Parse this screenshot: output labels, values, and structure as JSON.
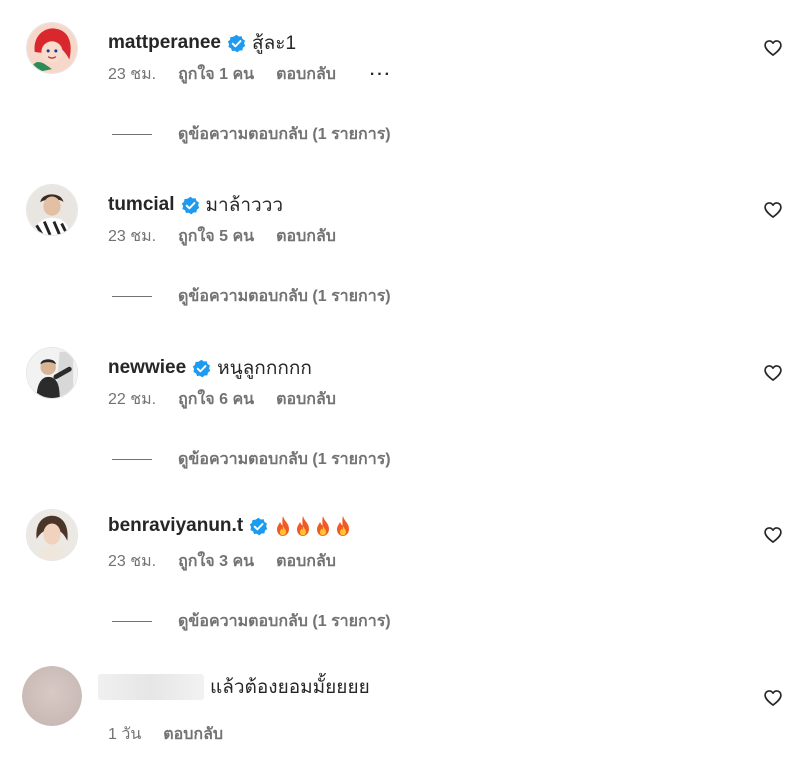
{
  "comments": [
    {
      "username": "mattperanee",
      "verified": true,
      "text": "สู้ละ1",
      "time": "23 ชม.",
      "likes": "ถูกใจ 1 คน",
      "reply": "ตอบกลับ",
      "more": "···",
      "view_replies": "ดูข้อความตอบกลับ (1 รายการ)",
      "avatar_icon": "cartoon-mermaid-avatar"
    },
    {
      "username": "tumcial",
      "verified": true,
      "text": "มาล้าววว",
      "time": "23 ชม.",
      "likes": "ถูกใจ 5 คน",
      "reply": "ตอบกลับ",
      "view_replies": "ดูข้อความตอบกลับ (1 รายการ)",
      "avatar_icon": "person-photo-avatar"
    },
    {
      "username": "newwiee",
      "verified": true,
      "text": "หนูลูกกกกก",
      "time": "22 ชม.",
      "likes": "ถูกใจ 6 คน",
      "reply": "ตอบกลับ",
      "view_replies": "ดูข้อความตอบกลับ (1 รายการ)",
      "avatar_icon": "person-photo-avatar"
    },
    {
      "username": "benraviyanun.t",
      "verified": true,
      "emoji": [
        "fire",
        "fire",
        "fire",
        "fire"
      ],
      "time": "23 ชม.",
      "likes": "ถูกใจ 3 คน",
      "reply": "ตอบกลับ",
      "view_replies": "ดูข้อความตอบกลับ (1 รายการ)",
      "avatar_icon": "person-photo-avatar"
    },
    {
      "username_blurred": true,
      "text": "แล้วต้องยอมมั้ยยยย",
      "time": "1 วัน",
      "reply": "ตอบกลับ",
      "avatar_icon": "blurred-avatar"
    }
  ],
  "colors": {
    "verified": "#1d9bf0",
    "text": "#262626",
    "secondary": "#737373",
    "fire": "#f15a24"
  }
}
